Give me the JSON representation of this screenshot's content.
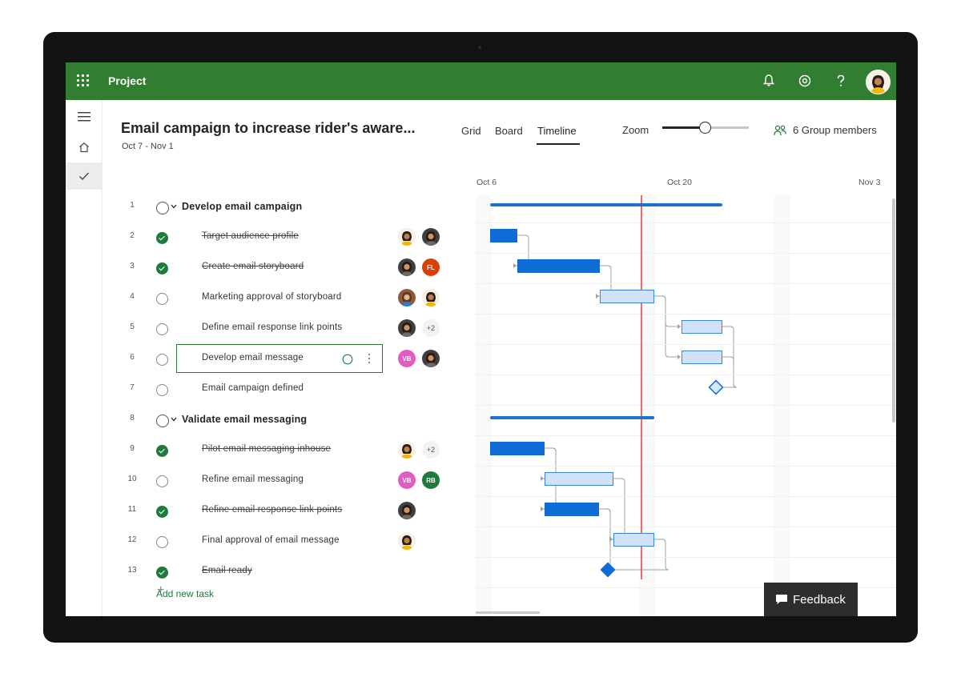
{
  "app": {
    "title": "Project"
  },
  "header": {
    "project_title": "Email campaign to increase rider's aware...",
    "dates": "Oct 7 - Nov 1",
    "tabs": [
      {
        "label": "Grid"
      },
      {
        "label": "Board"
      },
      {
        "label": "Timeline",
        "active": true
      }
    ],
    "zoom_label": "Zoom",
    "zoom_level": 0.5,
    "members_label": "6 Group members"
  },
  "timeline": {
    "dates": [
      "Oct 6",
      "Oct 20",
      "Nov 3"
    ]
  },
  "tasks": [
    {
      "num": "1",
      "name": "Develop email campaign",
      "parent": true,
      "done": false
    },
    {
      "num": "2",
      "name": "Target audience profile",
      "done": true,
      "assignees": [
        {
          "type": "photo-a"
        },
        {
          "type": "photo-b"
        }
      ]
    },
    {
      "num": "3",
      "name": "Create email storyboard",
      "done": true,
      "assignees": [
        {
          "type": "photo-b"
        },
        {
          "initials": "FL",
          "color": "#d74108"
        }
      ]
    },
    {
      "num": "4",
      "name": "Marketing approval of storyboard",
      "done": false,
      "assignees": [
        {
          "type": "photo-c"
        },
        {
          "type": "photo-a"
        }
      ]
    },
    {
      "num": "5",
      "name": "Define email response link points",
      "done": false,
      "assignees": [
        {
          "type": "photo-b"
        },
        {
          "more": "+2"
        }
      ]
    },
    {
      "num": "6",
      "name": "Develop email message",
      "done": false,
      "selected": true,
      "assignees": [
        {
          "initials": "VB",
          "color": "#e35cc4"
        },
        {
          "type": "photo-b"
        }
      ]
    },
    {
      "num": "7",
      "name": "Email campaign defined",
      "done": false,
      "milestone": true
    },
    {
      "num": "8",
      "name": "Validate email messaging",
      "parent": true,
      "done": false
    },
    {
      "num": "9",
      "name": "Pilot email messaging inhouse",
      "done": true,
      "assignees": [
        {
          "type": "photo-a"
        },
        {
          "more": "+2"
        }
      ]
    },
    {
      "num": "10",
      "name": "Refine email messaging",
      "done": false,
      "assignees": [
        {
          "initials": "VB",
          "color": "#e35cc4"
        },
        {
          "initials": "RB",
          "color": "#1f7a3d"
        }
      ]
    },
    {
      "num": "11",
      "name": "Refine email response link points",
      "done": true,
      "assignees": [
        {
          "type": "photo-b"
        }
      ]
    },
    {
      "num": "12",
      "name": "Final approval of email message",
      "done": false,
      "assignees": [
        {
          "type": "photo-a"
        }
      ]
    },
    {
      "num": "13",
      "name": "Email ready",
      "done": true,
      "milestone": true
    }
  ],
  "add_task_label": "Add new task",
  "feedback_label": "Feedback",
  "colors": {
    "brand": "#317d32",
    "bar": "#0f6cd6",
    "bar_light": "#cfe2f8",
    "today": "#e86a6a"
  }
}
